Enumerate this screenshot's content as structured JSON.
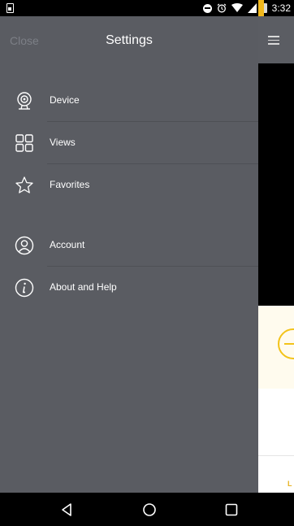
{
  "status_bar": {
    "time": "3:32",
    "icons": [
      "notification-icon",
      "do-not-disturb-icon",
      "alarm-icon",
      "wifi-icon",
      "signal-icon",
      "battery-icon"
    ]
  },
  "drawer": {
    "close_label": "Close",
    "title": "Settings",
    "items": [
      {
        "label": "Device",
        "icon": "camera-icon"
      },
      {
        "label": "Views",
        "icon": "grid-icon"
      },
      {
        "label": "Favorites",
        "icon": "star-icon"
      },
      {
        "label": "Account",
        "icon": "user-icon"
      },
      {
        "label": "About and Help",
        "icon": "info-icon"
      }
    ]
  },
  "right_panel": {
    "partial_text": "L"
  },
  "nav_bar": {
    "buttons": [
      "back-icon",
      "home-icon",
      "recents-icon"
    ]
  },
  "colors": {
    "drawer_bg": "#5a5c62",
    "accent": "#f1b81c",
    "text": "#ffffff",
    "muted": "#7c7f86"
  }
}
